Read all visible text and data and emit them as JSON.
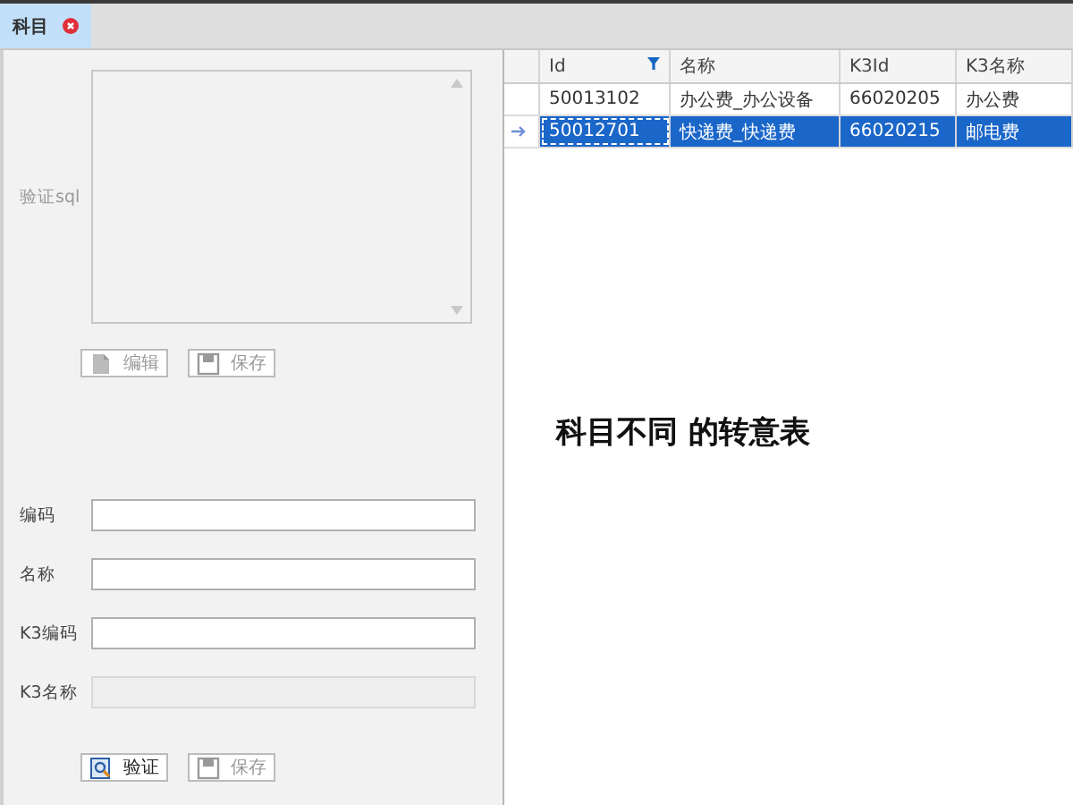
{
  "tabs": [
    {
      "label": "科目",
      "selected": true
    }
  ],
  "sql": {
    "label": "验证sql",
    "buttons": [
      {
        "kind": "edit",
        "label": "编辑",
        "disabled": true
      },
      {
        "kind": "save",
        "label": "保存",
        "disabled": true
      }
    ]
  },
  "form": {
    "fields": [
      {
        "label": "编码",
        "disabled": false
      },
      {
        "label": "名称",
        "disabled": false
      },
      {
        "label": "K3编码",
        "disabled": false
      },
      {
        "label": "K3名称",
        "disabled": true
      }
    ],
    "buttons": [
      {
        "kind": "verify",
        "label": "验证",
        "disabled": false
      },
      {
        "kind": "save",
        "label": "保存",
        "disabled": true
      }
    ]
  },
  "table": {
    "columns": [
      {
        "label": "Id",
        "filter": true
      },
      {
        "label": "名称",
        "filter": false
      },
      {
        "label": "K3Id",
        "filter": false
      },
      {
        "label": "K3名称",
        "filter": false
      }
    ],
    "rows": [
      {
        "cells": [
          "50013102",
          "办公费_办公设备",
          "66020205",
          "办公费"
        ],
        "selected": false,
        "current": false
      },
      {
        "cells": [
          "50012701",
          "快递费_快递费",
          "66020215",
          "邮电费"
        ],
        "selected": true,
        "current": true
      }
    ]
  },
  "heading": "科目不同 的转意表"
}
